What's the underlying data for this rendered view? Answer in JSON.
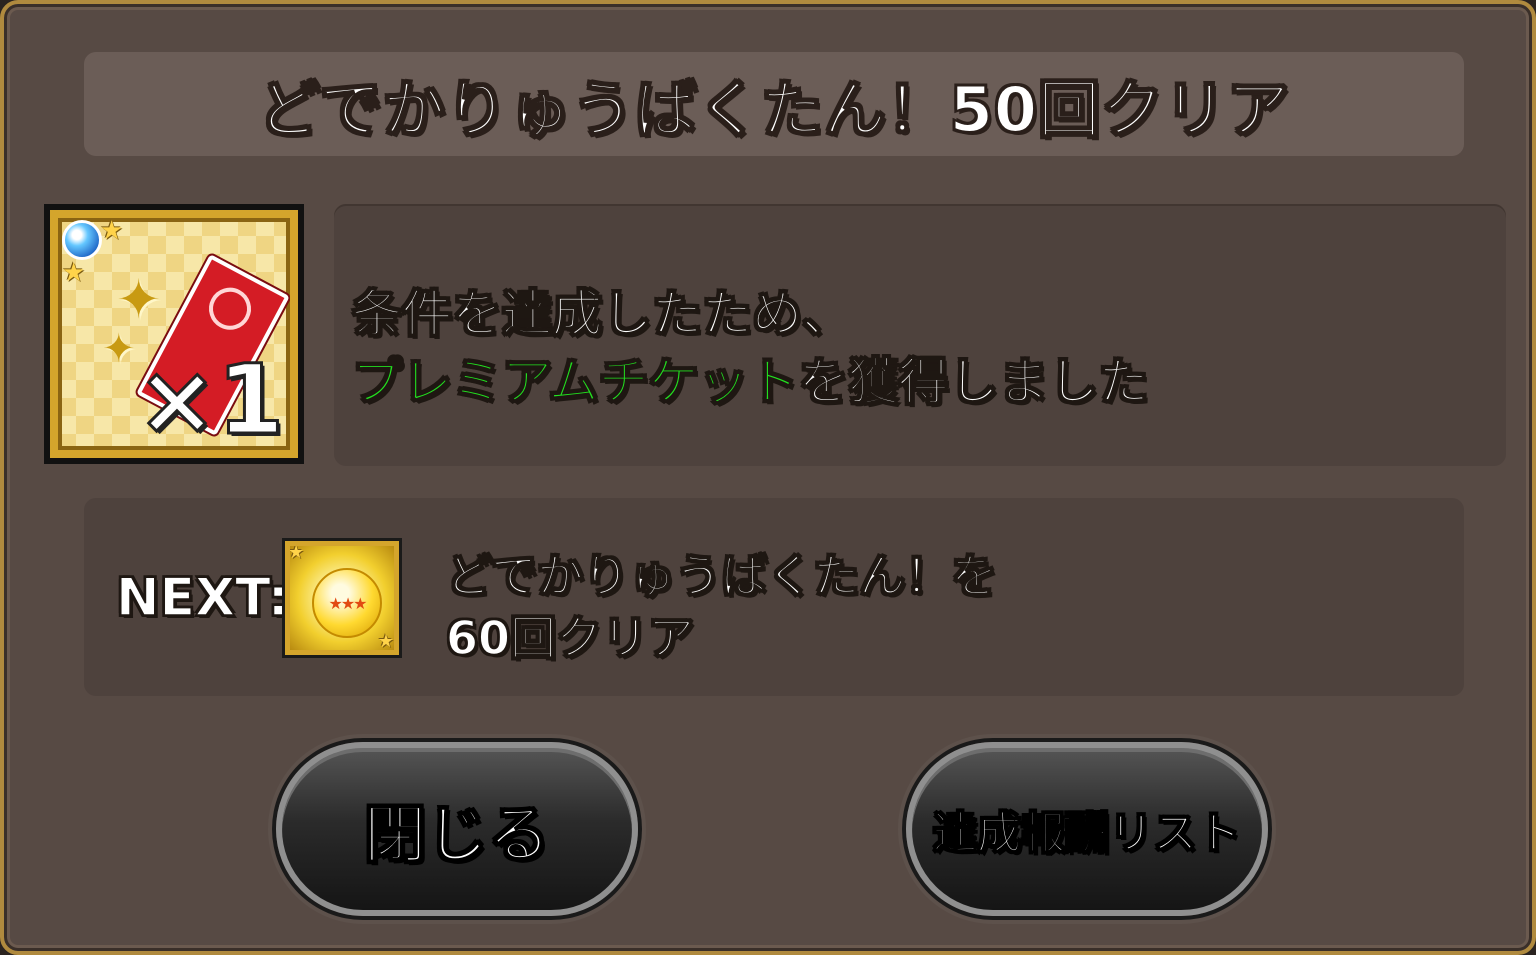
{
  "dialog": {
    "title": "どでかりゅうばくたん！50回クリア"
  },
  "reward": {
    "item_icon": "premium-ticket-icon",
    "quantity": "×1",
    "message_line1": "条件を達成したため、",
    "item_name": "プレミアムチケット",
    "message_suffix": "を獲得しました",
    "item_color": "#22e01f"
  },
  "next": {
    "label": "NEXT:",
    "item_icon": "star-orb-icon",
    "text_line1": "どでかりゅうばくたん！を",
    "text_line2": "60回クリア"
  },
  "buttons": {
    "close_label": "閉じる",
    "reward_list_label": "達成報酬リスト"
  }
}
